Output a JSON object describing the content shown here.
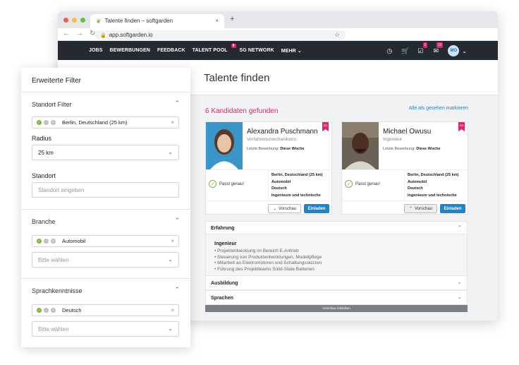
{
  "browser": {
    "tab_title": "Talente finden – softgarden",
    "tab_close": "×",
    "new_tab": "+",
    "url": "app.softgarden.io",
    "dot_colors": [
      "#ee5c55",
      "#f6bf3b",
      "#5bc443"
    ]
  },
  "nav": {
    "items": [
      {
        "label": "JOBS"
      },
      {
        "label": "BEWERBUNGEN"
      },
      {
        "label": "FEEDBACK"
      },
      {
        "label": "TALENT POOL",
        "badge": "9"
      },
      {
        "label": "SG NETWORK"
      },
      {
        "label": "MEHR ⌄"
      }
    ],
    "badges": {
      "tasks": "1",
      "messages": "13"
    },
    "avatar_initials": "MO",
    "accent_color": "#e6216f",
    "bar_color": "#242a2f"
  },
  "page": {
    "title": "Talente finden",
    "found": "6 Kandidaten gefunden",
    "mark_all": "Alle als gesehen markieren"
  },
  "candidates": [
    {
      "name": "Alexandra Puschmann",
      "role": "Verfahrensmechanikerin",
      "last_label": "Letzte Bewerbung:",
      "last_value": "Diese Woche",
      "match": "Passt genau!",
      "facts": [
        "Berlin, Deutschland (25 km)",
        "Automobil",
        "Deutsch",
        "Ingenieure und technische"
      ],
      "preview": "Vorschau",
      "invite": "Einladen",
      "ribbon": "SG"
    },
    {
      "name": "Michael Owusu",
      "role": "Ingenieur",
      "last_label": "Letzte Bewerbung:",
      "last_value": "Diese Woche",
      "match": "Passt genau!",
      "facts": [
        "Berlin, Deutschland (25 km)",
        "Automobil",
        "Deutsch",
        "Ingenieure und technische"
      ],
      "preview": "Vorschau",
      "invite": "Einladen",
      "ribbon": "SG"
    }
  ],
  "details": {
    "experience_title": "Erfahrung",
    "job_title": "Ingenieur",
    "bullets": [
      "Projektentwicklung im Bereich E-Antrieb",
      "Steuerung von Produktentwicklungen, Modellpflege",
      "Mitarbeit an Elektromotoren und Schaltungsskizzen",
      "Führung des Projektteams Solid-State Batterien"
    ],
    "education_title": "Ausbildung",
    "languages_title": "Sprachen",
    "close_preview": "Vorschau schließen"
  },
  "filter": {
    "title": "Erweiterte Filter",
    "location_section": "Standort Filter",
    "location_chip": "Berlin, Deutschland (25 km)",
    "radius_label": "Radius",
    "radius_value": "25 km",
    "standort_label": "Standort",
    "standort_placeholder": "Standort eingeben",
    "industry_section": "Branche",
    "industry_chip": "Automobil",
    "industry_placeholder": "Bitte wählen",
    "language_section": "Sprachkenntnisse",
    "language_chip": "Deutsch",
    "language_placeholder": "Bitte wählen"
  }
}
